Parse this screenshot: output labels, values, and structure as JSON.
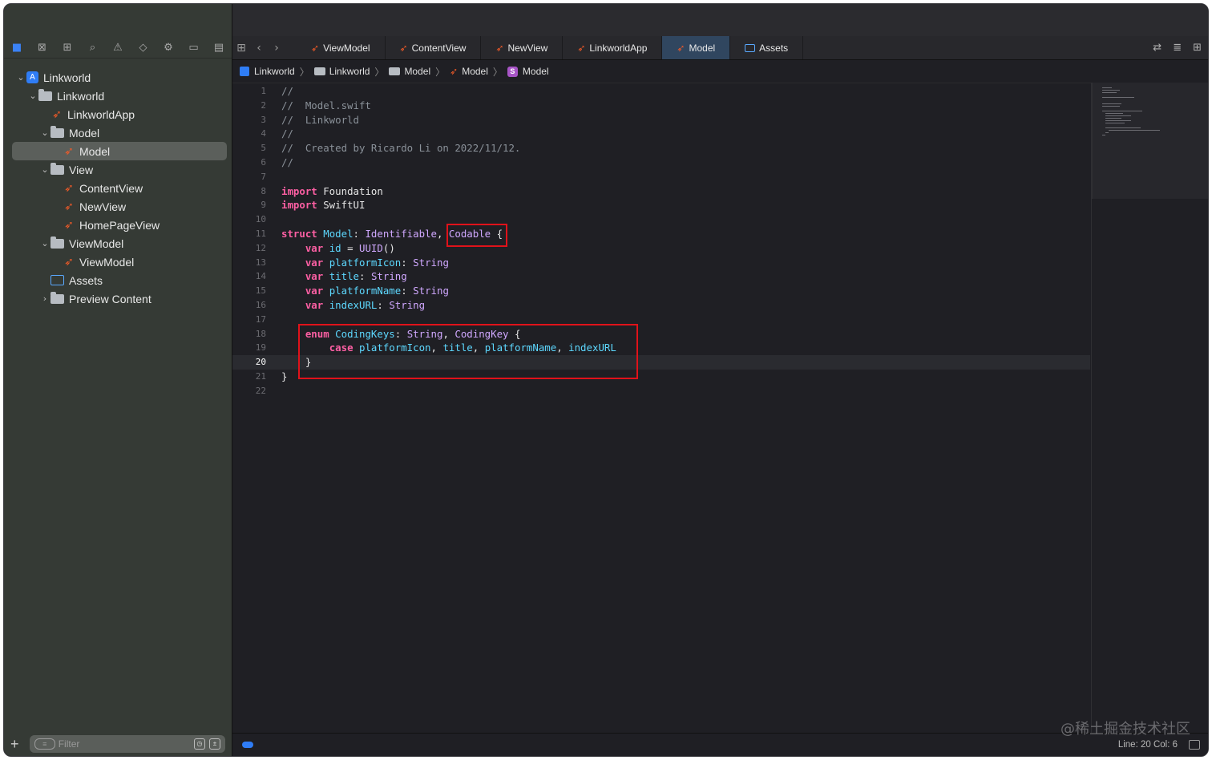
{
  "sidebar": {
    "tree": [
      {
        "label": "Linkworld",
        "kind": "project",
        "indent": 0,
        "chevron": "down"
      },
      {
        "label": "Linkworld",
        "kind": "folder",
        "indent": 1,
        "chevron": "down"
      },
      {
        "label": "LinkworldApp",
        "kind": "swift",
        "indent": 2,
        "chevron": ""
      },
      {
        "label": "Model",
        "kind": "folder",
        "indent": 2,
        "chevron": "down"
      },
      {
        "label": "Model",
        "kind": "swift",
        "indent": 3,
        "chevron": "",
        "selected": true
      },
      {
        "label": "View",
        "kind": "folder",
        "indent": 2,
        "chevron": "down"
      },
      {
        "label": "ContentView",
        "kind": "swift",
        "indent": 3,
        "chevron": ""
      },
      {
        "label": "NewView",
        "kind": "swift",
        "indent": 3,
        "chevron": ""
      },
      {
        "label": "HomePageView",
        "kind": "swift",
        "indent": 3,
        "chevron": ""
      },
      {
        "label": "ViewModel",
        "kind": "folder",
        "indent": 2,
        "chevron": "down"
      },
      {
        "label": "ViewModel",
        "kind": "swift",
        "indent": 3,
        "chevron": ""
      },
      {
        "label": "Assets",
        "kind": "assets",
        "indent": 2,
        "chevron": ""
      },
      {
        "label": "Preview Content",
        "kind": "folder",
        "indent": 2,
        "chevron": "right"
      }
    ],
    "filter_placeholder": "Filter"
  },
  "tabs": [
    {
      "label": "ViewModel",
      "icon": "swift-icon"
    },
    {
      "label": "ContentView",
      "icon": "swift-icon"
    },
    {
      "label": "NewView",
      "icon": "swift-icon"
    },
    {
      "label": "LinkworldApp",
      "icon": "swift-icon"
    },
    {
      "label": "Model",
      "icon": "swift-icon",
      "active": true
    },
    {
      "label": "Assets",
      "icon": "assets-icon"
    }
  ],
  "breadcrumb": [
    {
      "label": "Linkworld",
      "icon": "app"
    },
    {
      "label": "Linkworld",
      "icon": "folder"
    },
    {
      "label": "Model",
      "icon": "folder"
    },
    {
      "label": "Model",
      "icon": "swift"
    },
    {
      "label": "Model",
      "icon": "struct"
    }
  ],
  "code_lines": [
    [
      [
        "c-com",
        "//"
      ]
    ],
    [
      [
        "c-com",
        "//  Model.swift"
      ]
    ],
    [
      [
        "c-com",
        "//  Linkworld"
      ]
    ],
    [
      [
        "c-com",
        "//"
      ]
    ],
    [
      [
        "c-com",
        "//  Created by Ricardo Li on 2022/11/12."
      ]
    ],
    [
      [
        "c-com",
        "//"
      ]
    ],
    [],
    [
      [
        "c-kw",
        "import"
      ],
      [
        "c-plain",
        " Foundation"
      ]
    ],
    [
      [
        "c-kw",
        "import"
      ],
      [
        "c-plain",
        " SwiftUI"
      ]
    ],
    [],
    [
      [
        "c-kw",
        "struct"
      ],
      [
        "c-plain",
        " "
      ],
      [
        "c-decl",
        "Model"
      ],
      [
        "c-plain",
        ": "
      ],
      [
        "c-type",
        "Identifiable"
      ],
      [
        "c-plain",
        ", "
      ],
      [
        "c-type",
        "Codable"
      ],
      [
        "c-plain",
        " {"
      ]
    ],
    [
      [
        "c-plain",
        "    "
      ],
      [
        "c-kw",
        "var"
      ],
      [
        "c-plain",
        " "
      ],
      [
        "c-decl",
        "id"
      ],
      [
        "c-plain",
        " = "
      ],
      [
        "c-type",
        "UUID"
      ],
      [
        "c-plain",
        "()"
      ]
    ],
    [
      [
        "c-plain",
        "    "
      ],
      [
        "c-kw",
        "var"
      ],
      [
        "c-plain",
        " "
      ],
      [
        "c-decl",
        "platformIcon"
      ],
      [
        "c-plain",
        ": "
      ],
      [
        "c-type",
        "String"
      ]
    ],
    [
      [
        "c-plain",
        "    "
      ],
      [
        "c-kw",
        "var"
      ],
      [
        "c-plain",
        " "
      ],
      [
        "c-decl",
        "title"
      ],
      [
        "c-plain",
        ": "
      ],
      [
        "c-type",
        "String"
      ]
    ],
    [
      [
        "c-plain",
        "    "
      ],
      [
        "c-kw",
        "var"
      ],
      [
        "c-plain",
        " "
      ],
      [
        "c-decl",
        "platformName"
      ],
      [
        "c-plain",
        ": "
      ],
      [
        "c-type",
        "String"
      ]
    ],
    [
      [
        "c-plain",
        "    "
      ],
      [
        "c-kw",
        "var"
      ],
      [
        "c-plain",
        " "
      ],
      [
        "c-decl",
        "indexURL"
      ],
      [
        "c-plain",
        ": "
      ],
      [
        "c-type",
        "String"
      ]
    ],
    [],
    [
      [
        "c-plain",
        "    "
      ],
      [
        "c-kw",
        "enum"
      ],
      [
        "c-plain",
        " "
      ],
      [
        "c-decl",
        "CodingKeys"
      ],
      [
        "c-plain",
        ": "
      ],
      [
        "c-type",
        "String"
      ],
      [
        "c-plain",
        ", "
      ],
      [
        "c-type",
        "CodingKey"
      ],
      [
        "c-plain",
        " {"
      ]
    ],
    [
      [
        "c-plain",
        "        "
      ],
      [
        "c-kw",
        "case"
      ],
      [
        "c-plain",
        " "
      ],
      [
        "c-decl",
        "platformIcon"
      ],
      [
        "c-plain",
        ", "
      ],
      [
        "c-decl",
        "title"
      ],
      [
        "c-plain",
        ", "
      ],
      [
        "c-decl",
        "platformName"
      ],
      [
        "c-plain",
        ", "
      ],
      [
        "c-decl",
        "indexURL"
      ]
    ],
    [
      [
        "c-plain",
        "    }"
      ]
    ],
    [
      [
        "c-plain",
        "}"
      ]
    ],
    []
  ],
  "current_line": 20,
  "status": {
    "position": "Line: 20  Col: 6"
  },
  "watermark": "@稀土掘金技术社区",
  "colors": {
    "accent": "#2f7df6",
    "swift": "#f05a28",
    "highlight_box": "#e0121a",
    "keyword": "#fc5fa3",
    "type": "#d0a8ff",
    "declaration": "#5dd8ff"
  }
}
